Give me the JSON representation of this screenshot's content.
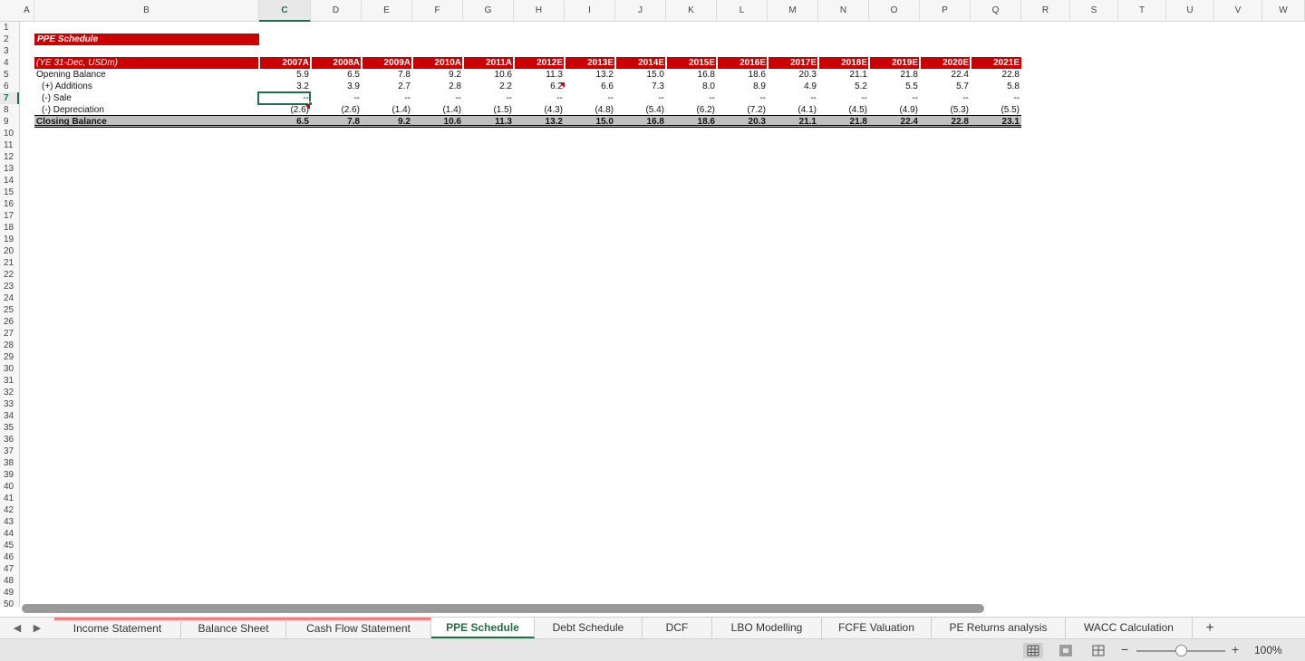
{
  "columns": [
    "A",
    "B",
    "C",
    "D",
    "E",
    "F",
    "G",
    "H",
    "I",
    "J",
    "K",
    "L",
    "M",
    "N",
    "O",
    "P",
    "Q",
    "R",
    "S",
    "T",
    "U",
    "V",
    "W"
  ],
  "selected_column": "C",
  "selected_row": 7,
  "row_count": 50,
  "title": "PPE Schedule",
  "header_label": "(YE 31-Dec, USDm)",
  "years": [
    "2007A",
    "2008A",
    "2009A",
    "2010A",
    "2011A",
    "2012E",
    "2013E",
    "2014E",
    "2015E",
    "2016E",
    "2017E",
    "2018E",
    "2019E",
    "2020E",
    "2021E"
  ],
  "rows": [
    {
      "label": "Opening Balance",
      "values": [
        "5.9",
        "6.5",
        "7.8",
        "9.2",
        "10.6",
        "11.3",
        "13.2",
        "15.0",
        "16.8",
        "18.6",
        "20.3",
        "21.1",
        "21.8",
        "22.4",
        "22.8"
      ]
    },
    {
      "label": "(+) Additions",
      "values": [
        "3.2",
        "3.9",
        "2.7",
        "2.8",
        "2.2",
        "6.2",
        "6.6",
        "7.3",
        "8.0",
        "8.9",
        "4.9",
        "5.2",
        "5.5",
        "5.7",
        "5.8"
      ]
    },
    {
      "label": "(-) Sale",
      "values": [
        "--",
        "--",
        "--",
        "--",
        "--",
        "--",
        "--",
        "--",
        "--",
        "--",
        "--",
        "--",
        "--",
        "--",
        "--"
      ]
    },
    {
      "label": "(-) Depreciation",
      "values": [
        "(2.6)",
        "(2.6)",
        "(1.4)",
        "(1.4)",
        "(1.5)",
        "(4.3)",
        "(4.8)",
        "(5.4)",
        "(6.2)",
        "(7.2)",
        "(4.1)",
        "(4.5)",
        "(4.9)",
        "(5.3)",
        "(5.5)"
      ]
    },
    {
      "label": "Closing Balance",
      "values": [
        "6.5",
        "7.8",
        "9.2",
        "10.6",
        "11.3",
        "13.2",
        "15.0",
        "16.8",
        "18.6",
        "20.3",
        "21.1",
        "21.8",
        "22.4",
        "22.8",
        "23.1"
      ]
    }
  ],
  "sheet_tabs": [
    {
      "label": "Income Statement"
    },
    {
      "label": "Balance Sheet"
    },
    {
      "label": "Cash Flow Statement"
    },
    {
      "label": "PPE Schedule"
    },
    {
      "label": "Debt Schedule"
    },
    {
      "label": "DCF"
    },
    {
      "label": "LBO Modelling"
    },
    {
      "label": "FCFE Valuation"
    },
    {
      "label": "PE Returns analysis"
    },
    {
      "label": "WACC Calculation"
    }
  ],
  "active_tab": "PPE Schedule",
  "add_sheet_label": "+",
  "zoom": {
    "label": "100%",
    "minus": "−",
    "plus": "+"
  },
  "colors": {
    "accent": "#1e7145",
    "header_red": "#cc0000",
    "total_gray": "#bfbfbf"
  }
}
